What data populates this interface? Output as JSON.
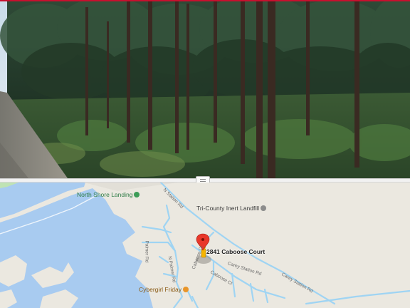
{
  "map": {
    "pois": {
      "north_shore_landing": "North Shore Landing",
      "landfill": "Tri-County Inert Landfill",
      "cybergirl": "Cybergirl Friday"
    },
    "address": "2841 Caboose Court",
    "roads": {
      "station_rd_top": "N Station Rd",
      "carey_station_rd": "Carey Station Rd",
      "carey_station_rd_2": "Carey Station Rd",
      "caboose_ct": "Caboose Ct",
      "caboose_ct_2": "Caboose Ct",
      "palmer_rd": "Palmer Rd",
      "n_palmer_rd": "N Palmer Rd"
    },
    "icons": {
      "pin": "map-pin-icon",
      "park": "park-icon",
      "place": "place-icon",
      "shopping": "shopping-icon"
    }
  },
  "colors": {
    "water": "#a8cbf0",
    "land": "#ebe8e0",
    "road": "#9fd4f3",
    "pin": "#e8372a",
    "pegman": "#f5b400",
    "top_border": "#c8102e"
  }
}
